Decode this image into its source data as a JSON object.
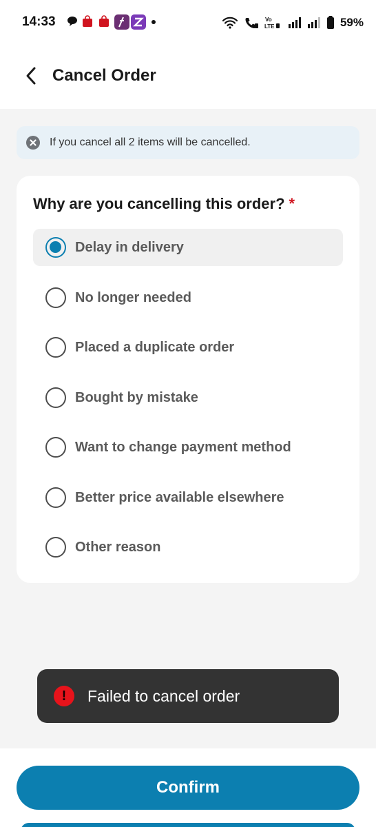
{
  "status_bar": {
    "time": "14:33",
    "battery": "59%",
    "network_label": "Vo LTE"
  },
  "header": {
    "title": "Cancel Order",
    "back_icon": "chevron-left-icon"
  },
  "info_banner": {
    "text": "If you cancel all 2 items will be cancelled.",
    "icon": "close-circle-icon"
  },
  "reasons": {
    "question": "Why are you cancelling this order?",
    "required_mark": "*",
    "options": [
      {
        "label": "Delay in delivery",
        "selected": true
      },
      {
        "label": "No longer needed",
        "selected": false
      },
      {
        "label": "Placed a duplicate order",
        "selected": false
      },
      {
        "label": "Bought by mistake",
        "selected": false
      },
      {
        "label": "Want to change payment method",
        "selected": false
      },
      {
        "label": "Better price available elsewhere",
        "selected": false
      },
      {
        "label": "Other reason",
        "selected": false
      }
    ]
  },
  "toast": {
    "text": "Failed to cancel order",
    "icon_glyph": "!"
  },
  "footer": {
    "confirm_label": "Confirm"
  },
  "colors": {
    "accent": "#0c7fb0",
    "error": "#e8131b",
    "toast_bg": "#333333",
    "banner_bg": "#e8f1f7"
  }
}
